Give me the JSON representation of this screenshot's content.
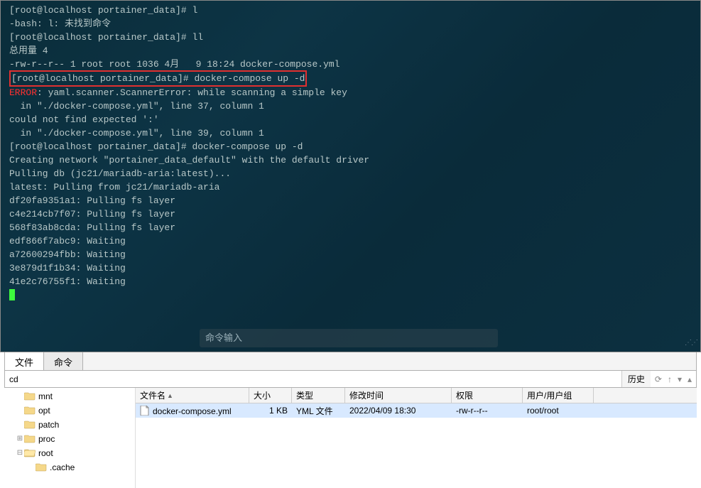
{
  "terminal": {
    "lines": [
      {
        "segs": [
          {
            "t": "[root@localhost portainer_data]# ",
            "c": ""
          },
          {
            "t": "l",
            "c": ""
          }
        ]
      },
      {
        "segs": [
          {
            "t": "-bash: l: 未找到命令",
            "c": ""
          }
        ]
      },
      {
        "segs": [
          {
            "t": "[root@localhost portainer_data]# ",
            "c": ""
          },
          {
            "t": "ll",
            "c": ""
          }
        ]
      },
      {
        "segs": [
          {
            "t": "总用量 4",
            "c": ""
          }
        ]
      },
      {
        "segs": [
          {
            "t": "-rw-r--r-- 1 root root 1036 4月   9 18:24 docker-compose.yml",
            "c": ""
          }
        ]
      },
      {
        "segs": [
          {
            "t": "[root@localhost portainer_data]# docker-compose up -d",
            "c": ""
          }
        ],
        "redbox": true
      },
      {
        "segs": [
          {
            "t": "ERROR",
            "c": "t-red"
          },
          {
            "t": ": yaml.scanner.ScannerError: while scanning a simple key",
            "c": ""
          }
        ]
      },
      {
        "segs": [
          {
            "t": "  in \"./docker-compose.yml\", line 37, column 1",
            "c": ""
          }
        ]
      },
      {
        "segs": [
          {
            "t": "could not find expected ':'",
            "c": ""
          }
        ]
      },
      {
        "segs": [
          {
            "t": "  in \"./docker-compose.yml\", line 39, column 1",
            "c": ""
          }
        ]
      },
      {
        "segs": [
          {
            "t": "[root@localhost portainer_data]# ",
            "c": ""
          },
          {
            "t": "docker-compose up -d",
            "c": ""
          }
        ]
      },
      {
        "segs": [
          {
            "t": "Creating network \"portainer_data_default\" with the default driver",
            "c": ""
          }
        ]
      },
      {
        "segs": [
          {
            "t": "Pulling db (jc21/mariadb-aria:latest)...",
            "c": ""
          }
        ]
      },
      {
        "segs": [
          {
            "t": "latest: Pulling from jc21/mariadb-aria",
            "c": ""
          }
        ]
      },
      {
        "segs": [
          {
            "t": "df20fa9351a1: Pulling fs layer",
            "c": ""
          }
        ]
      },
      {
        "segs": [
          {
            "t": "c4e214cb7f07: Pulling fs layer",
            "c": ""
          }
        ]
      },
      {
        "segs": [
          {
            "t": "568f83ab8cda: Pulling fs layer",
            "c": ""
          }
        ]
      },
      {
        "segs": [
          {
            "t": "edf866f7abc9: Waiting",
            "c": ""
          }
        ]
      },
      {
        "segs": [
          {
            "t": "a72600294fbb: Waiting",
            "c": ""
          }
        ]
      },
      {
        "segs": [
          {
            "t": "3e879d1f1b34: Waiting",
            "c": ""
          }
        ]
      },
      {
        "segs": [
          {
            "t": "41e2c76755f1: Waiting",
            "c": ""
          }
        ]
      }
    ],
    "cmd_input_placeholder": "命令输入"
  },
  "tabs": [
    {
      "label": "文件",
      "active": true
    },
    {
      "label": "命令",
      "active": false
    }
  ],
  "path_bar": {
    "text": "cd",
    "history_btn": "历史"
  },
  "tree": [
    {
      "indent": 1,
      "exp": "",
      "label": "mnt",
      "sel": false,
      "open": false
    },
    {
      "indent": 1,
      "exp": "",
      "label": "opt",
      "sel": false,
      "open": false
    },
    {
      "indent": 1,
      "exp": "",
      "label": "patch",
      "sel": false,
      "open": false
    },
    {
      "indent": 1,
      "exp": "⊞",
      "label": "proc",
      "sel": false,
      "open": false
    },
    {
      "indent": 1,
      "exp": "⊟",
      "label": "root",
      "sel": false,
      "open": true
    },
    {
      "indent": 2,
      "exp": "",
      "label": ".cache",
      "sel": false,
      "open": false
    }
  ],
  "file_list": {
    "headers": {
      "name": "文件名",
      "size": "大小",
      "type": "类型",
      "mtime": "修改时间",
      "perm": "权限",
      "owner": "用户/用户组"
    },
    "rows": [
      {
        "name": "docker-compose.yml",
        "size": "1 KB",
        "type": "YML 文件",
        "mtime": "2022/04/09 18:30",
        "perm": "-rw-r--r--",
        "owner": "root/root",
        "sel": true
      }
    ]
  },
  "colors": {
    "folder_closed": "#f5d88a",
    "folder_open": "#f5d88a",
    "file_icon": "#e0e0e0"
  }
}
